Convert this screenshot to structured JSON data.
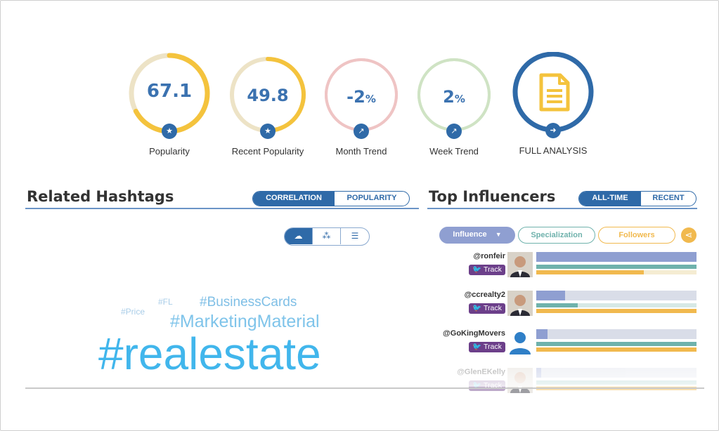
{
  "metrics": [
    {
      "value": "67.1",
      "suffix": "",
      "label": "Popularity",
      "color": "#f4c33d",
      "track": "#ede3c6",
      "progress": 0.671,
      "badge": "star-icon"
    },
    {
      "value": "49.8",
      "suffix": "",
      "label": "Recent Popularity",
      "color": "#f4c33d",
      "track": "#ede3c6",
      "progress": 0.498,
      "badge": "star-icon"
    },
    {
      "value": "-2",
      "suffix": "%",
      "label": "Month Trend",
      "color": "#efc4c4",
      "track": "#efc4c4",
      "progress": 1,
      "badge": "trend-icon"
    },
    {
      "value": "2",
      "suffix": "%",
      "label": "Week Trend",
      "color": "#cfe3c4",
      "track": "#cfe3c4",
      "progress": 1,
      "badge": "trend-icon"
    }
  ],
  "full_analysis": {
    "label": "FULL ANALYSIS",
    "color": "#2f6aa8",
    "icon_color": "#f4c33d"
  },
  "related": {
    "title": "Related Hashtags",
    "toggle": [
      "CORRELATION",
      "POPULARITY"
    ],
    "active": 0,
    "words": [
      {
        "text": "#Price",
        "color": "#a9cde8"
      },
      {
        "text": "#FL",
        "color": "#a9cde8"
      },
      {
        "text": "#BusinessCards",
        "color": "#7fbfe6"
      },
      {
        "text": "#MarketingMaterial",
        "color": "#7fc4ea"
      },
      {
        "text": "#realestate",
        "color": "#41b6ec"
      }
    ]
  },
  "influencers": {
    "title": "Top Influencers",
    "toggle": [
      "ALL-TIME",
      "RECENT"
    ],
    "active": 0,
    "filters": [
      "Influence",
      "Specialization",
      "Followers"
    ],
    "track_label": "Track",
    "rows": [
      {
        "handle": "@ronfeir",
        "influence": 1.0,
        "specialization": 1.0,
        "followers": 0.67
      },
      {
        "handle": "@ccrealty2",
        "influence": 0.18,
        "specialization": 0.26,
        "followers": 1.0
      },
      {
        "handle": "@GoKingMovers",
        "influence": 0.07,
        "specialization": 1.0,
        "followers": 1.0
      },
      {
        "handle": "@GlenEKelly",
        "influence": 0.03,
        "specialization": 1.0,
        "followers": 1.0
      }
    ],
    "colors": {
      "influence": "#8f9fd1",
      "specialization": "#6fb2ac",
      "followers": "#f1b94e"
    }
  }
}
